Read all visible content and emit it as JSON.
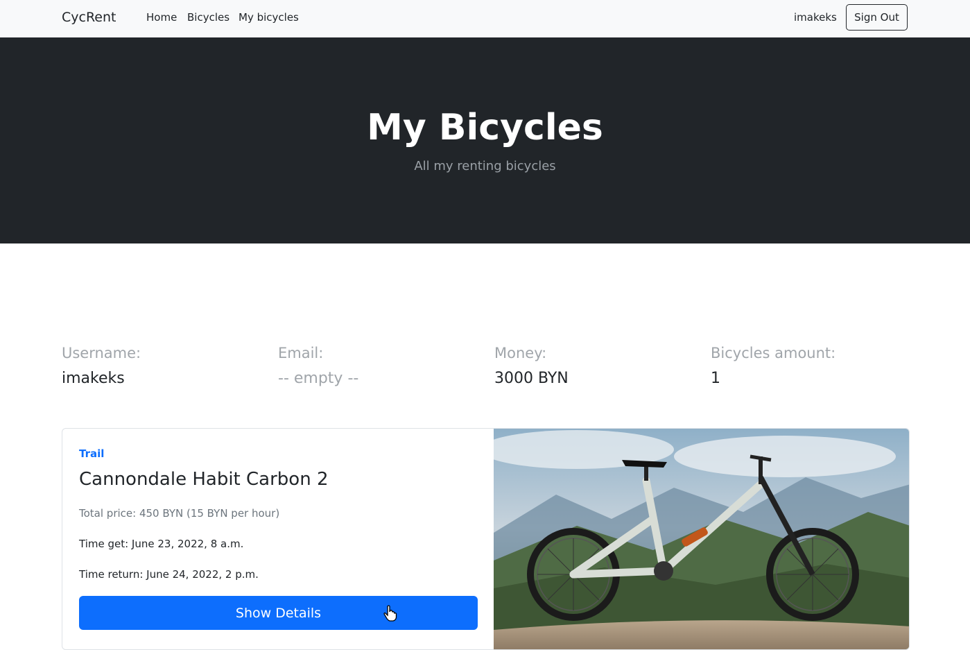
{
  "navbar": {
    "brand": "CycRent",
    "links": [
      "Home",
      "Bicycles",
      "My bicycles"
    ],
    "username": "imakeks",
    "signout_label": "Sign Out"
  },
  "hero": {
    "title": "My Bicycles",
    "subtitle": "All my renting bicycles"
  },
  "stats": [
    {
      "label": "Username:",
      "value": "imakeks"
    },
    {
      "label": "Email:",
      "value": "-- empty --"
    },
    {
      "label": "Money:",
      "value": "3000 BYN"
    },
    {
      "label": "Bicycles amount:",
      "value": "1"
    }
  ],
  "rental": {
    "category": "Trail",
    "name": "Cannondale Habit Carbon 2",
    "price": "Total price: 450 BYN (15 BYN per hour)",
    "time_get": "Time get: June 23, 2022, 8 a.m.",
    "time_return": "Time return: June 24, 2022, 2 p.m.",
    "button_label": "Show Details",
    "image_icon": "bicycle-photo"
  },
  "colors": {
    "primary": "#0d6efd",
    "dark": "#212529",
    "muted": "#a0a5aa",
    "navbar_bg": "#f8f9fa"
  }
}
